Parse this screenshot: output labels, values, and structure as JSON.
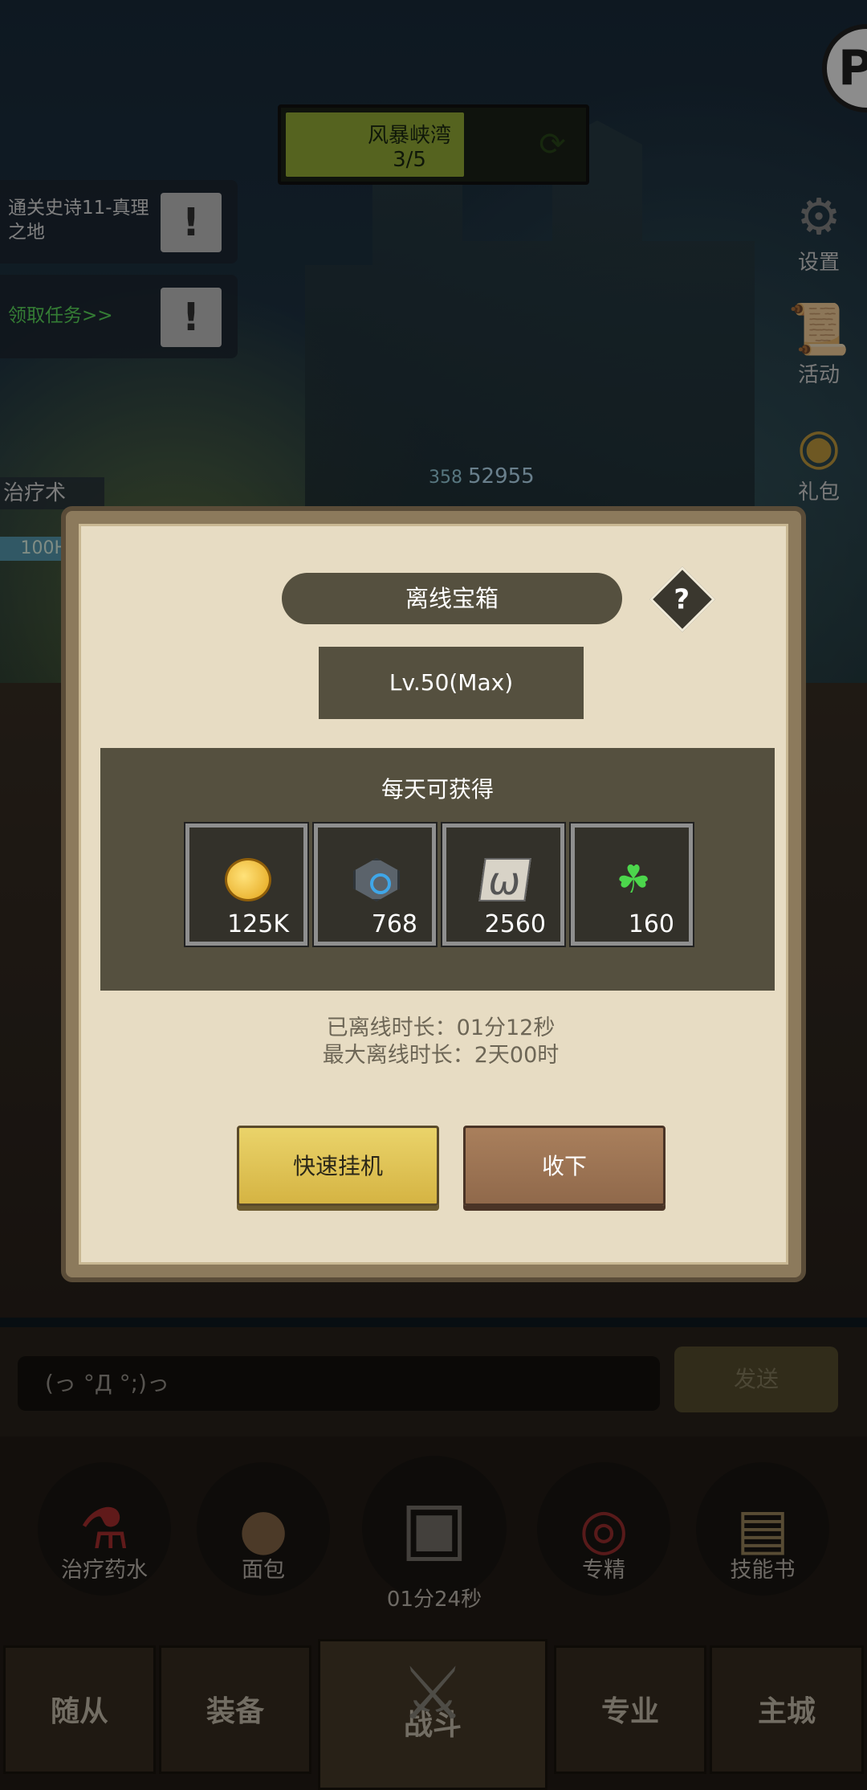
{
  "stage": {
    "name": "风暴峡湾",
    "progress_text": "3/5",
    "progress": 0.6
  },
  "corner_button": {
    "label": "P"
  },
  "quests": [
    {
      "text": "通关史诗11-真理之地",
      "icon": "exclamation"
    },
    {
      "text": "领取任务>>",
      "icon": "exclamation"
    }
  ],
  "side_menu": [
    {
      "label": "设置",
      "icon": "gear-icon"
    },
    {
      "label": "活动",
      "icon": "scroll-icon"
    },
    {
      "label": "礼包",
      "icon": "gift-icon"
    }
  ],
  "battle": {
    "skill": "治疗术",
    "hp": "100H",
    "hero_level": "358",
    "hero_power": "52955"
  },
  "dialog": {
    "title": "离线宝箱",
    "help": "?",
    "level": "Lv.50(Max)",
    "rewards_title": "每天可获得",
    "rewards": [
      {
        "icon": "gold-coin-icon",
        "value": "125K"
      },
      {
        "icon": "gem-icon",
        "value": "768"
      },
      {
        "icon": "scroll-icon",
        "value": "2560"
      },
      {
        "icon": "clover-icon",
        "value": "160"
      }
    ],
    "offline_duration": "已离线时长：01分12秒",
    "max_offline_duration": "最大离线时长：2天00时",
    "quick_afk_label": "快速挂机",
    "collect_label": "收下"
  },
  "chat": {
    "input_value": "(っ °Д °;)っ",
    "send_label": "发送"
  },
  "consumables": [
    {
      "label": "治疗药水",
      "icon": "potion-icon"
    },
    {
      "label": "面包",
      "icon": "bread-icon"
    },
    {
      "label": "专精",
      "icon": "mastery-icon"
    },
    {
      "label": "技能书",
      "icon": "skill-book-icon"
    }
  ],
  "chest": {
    "timer": "01分24秒",
    "icon": "treasure-chest-icon"
  },
  "tabs": [
    {
      "label": "随从"
    },
    {
      "label": "装备"
    },
    {
      "label": "战斗",
      "active": true
    },
    {
      "label": "专业"
    },
    {
      "label": "主城"
    }
  ]
}
